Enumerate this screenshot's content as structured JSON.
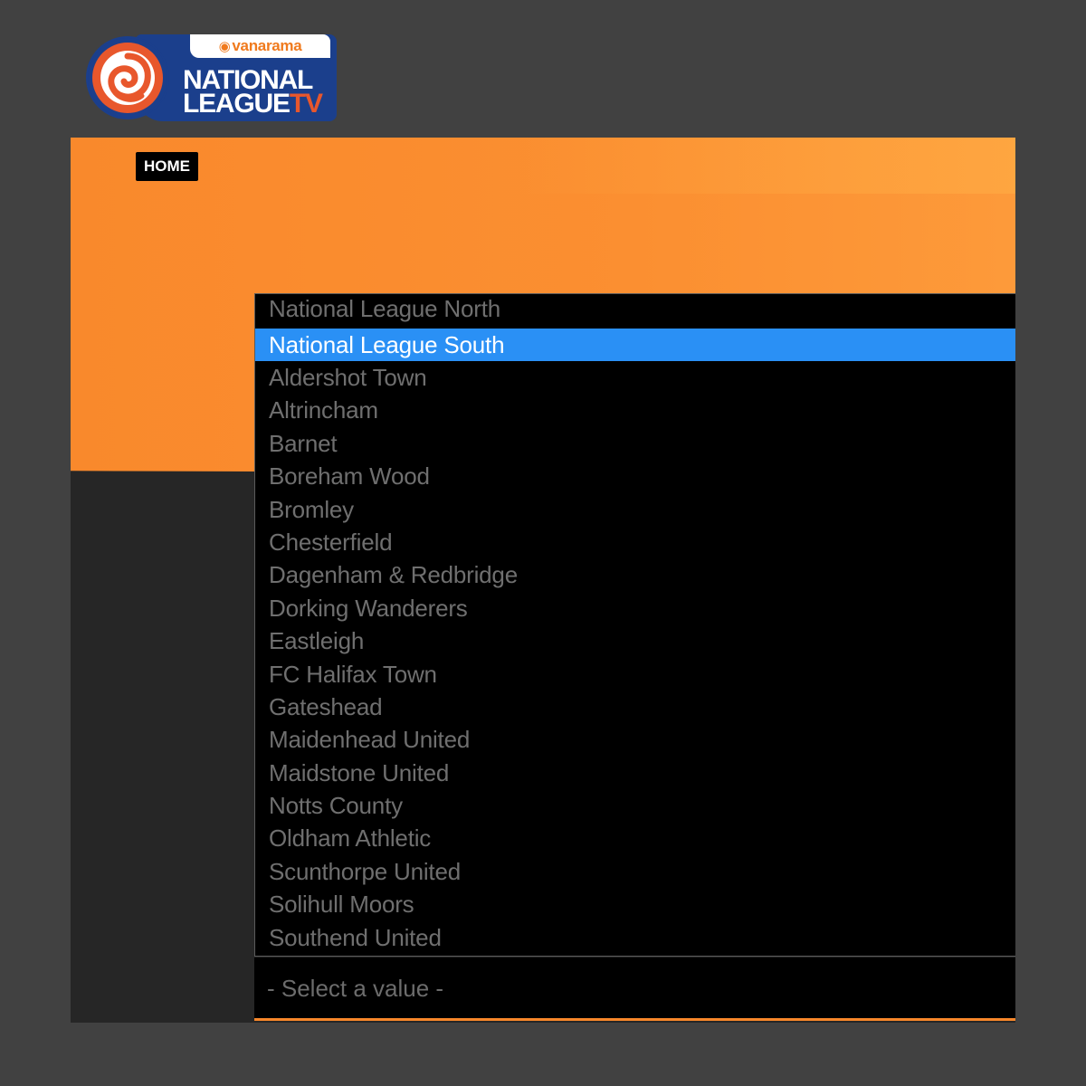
{
  "logo": {
    "sponsor": "vanarama",
    "line1": "NATIONAL",
    "line2_main": "LEAGUE",
    "line2_suffix": "TV",
    "icon": "rose-icon"
  },
  "nav": {
    "home_label": "HOME"
  },
  "dropdown": {
    "options": [
      "National League North",
      "National League South",
      "Aldershot Town",
      "Altrincham",
      "Barnet",
      "Boreham Wood",
      "Bromley",
      "Chesterfield",
      "Dagenham & Redbridge",
      "Dorking Wanderers",
      "Eastleigh",
      "FC Halifax Town",
      "Gateshead",
      "Maidenhead United",
      "Maidstone United",
      "Notts County",
      "Oldham Athletic",
      "Scunthorpe United",
      "Solihull Moors",
      "Southend United"
    ],
    "highlighted": "National League South",
    "placeholder": "- Select a value -"
  },
  "colors": {
    "page_bg": "#414141",
    "banner": "#f9892c",
    "highlight": "#2a90f5",
    "brand_blue": "#1b3f8c",
    "brand_red": "#e8572c"
  }
}
